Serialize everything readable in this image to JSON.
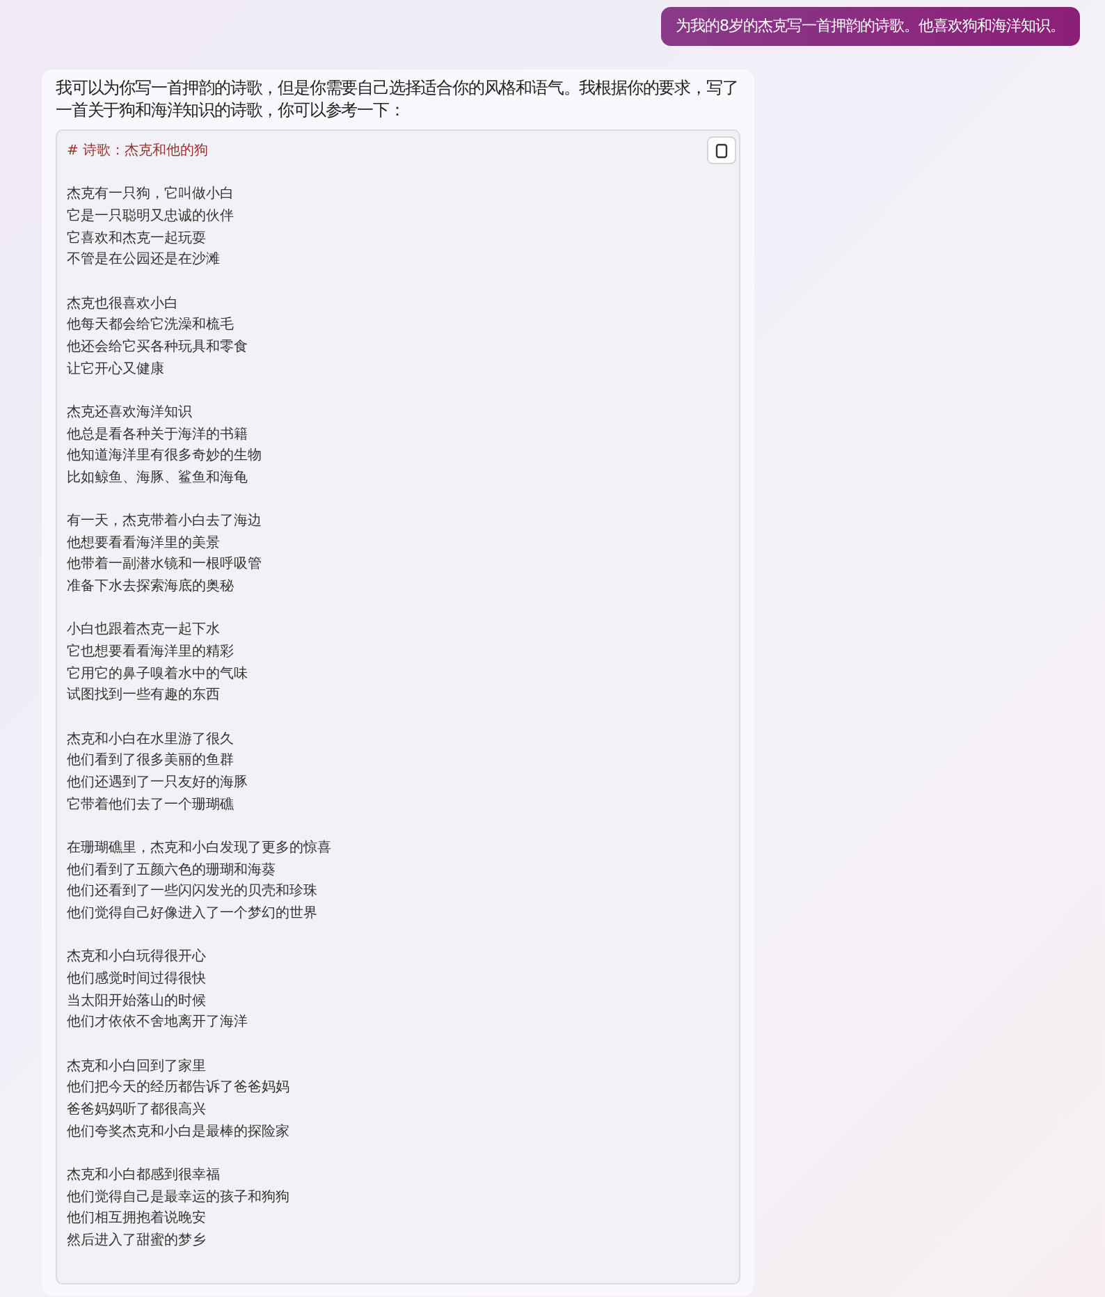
{
  "user_message": "为我的8岁的杰克写一首押韵的诗歌。他喜欢狗和海洋知识。",
  "reply": {
    "intro": "我可以为你写一首押韵的诗歌，但是你需要自己选择适合你的风格和语气。我根据你的要求，写了一首关于狗和海洋知识的诗歌，你可以参考一下：",
    "code_block": {
      "heading": "# 诗歌：杰克和他的狗",
      "stanzas": [
        [
          "杰克有一只狗，它叫做小白",
          "它是一只聪明又忠诚的伙伴",
          "它喜欢和杰克一起玩耍",
          "不管是在公园还是在沙滩"
        ],
        [
          "杰克也很喜欢小白",
          "他每天都会给它洗澡和梳毛",
          "他还会给它买各种玩具和零食",
          "让它开心又健康"
        ],
        [
          "杰克还喜欢海洋知识",
          "他总是看各种关于海洋的书籍",
          "他知道海洋里有很多奇妙的生物",
          "比如鲸鱼、海豚、鲨鱼和海龟"
        ],
        [
          "有一天，杰克带着小白去了海边",
          "他想要看看海洋里的美景",
          "他带着一副潜水镜和一根呼吸管",
          "准备下水去探索海底的奥秘"
        ],
        [
          "小白也跟着杰克一起下水",
          "它也想要看看海洋里的精彩",
          "它用它的鼻子嗅着水中的气味",
          "试图找到一些有趣的东西"
        ],
        [
          "杰克和小白在水里游了很久",
          "他们看到了很多美丽的鱼群",
          "他们还遇到了一只友好的海豚",
          "它带着他们去了一个珊瑚礁"
        ],
        [
          "在珊瑚礁里，杰克和小白发现了更多的惊喜",
          "他们看到了五颜六色的珊瑚和海葵",
          "他们还看到了一些闪闪发光的贝壳和珍珠",
          "他们觉得自己好像进入了一个梦幻的世界"
        ],
        [
          "杰克和小白玩得很开心",
          "他们感觉时间过得很快",
          "当太阳开始落山的时候",
          "他们才依依不舍地离开了海洋"
        ],
        [
          "杰克和小白回到了家里",
          "他们把今天的经历都告诉了爸爸妈妈",
          "爸爸妈妈听了都很高兴",
          "他们夸奖杰克和小白是最棒的探险家"
        ],
        [
          "杰克和小白都感到很幸福",
          "他们觉得自己是最幸运的孩子和狗狗",
          "他们相互拥抱着说晚安",
          "然后进入了甜蜜的梦乡"
        ]
      ]
    }
  }
}
